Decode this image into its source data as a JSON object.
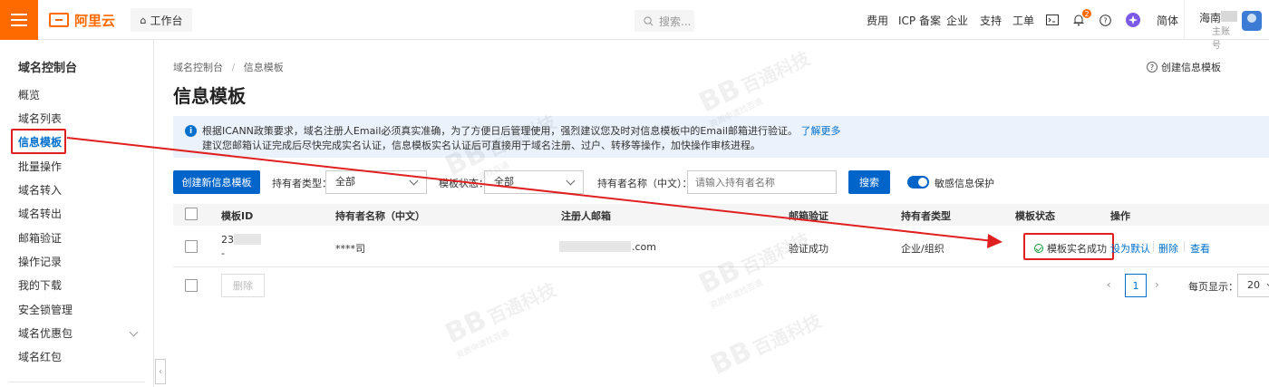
{
  "topbar": {
    "logo_text": "阿里云",
    "workbench_label": "工作台",
    "search_placeholder": "搜索...",
    "nav": [
      "费用",
      "ICP 备案",
      "企业",
      "支持",
      "工单"
    ],
    "notification_count": "2",
    "lang_label": "简体",
    "account_name": "海南",
    "account_role": "主账号"
  },
  "sidebar": {
    "title": "域名控制台",
    "items": [
      "概览",
      "域名列表",
      "信息模板",
      "批量操作",
      "域名转入",
      "域名转出",
      "邮箱验证",
      "操作记录",
      "我的下载",
      "安全锁管理",
      "域名优惠包",
      "域名红包"
    ]
  },
  "main": {
    "breadcrumb_root": "域名控制台",
    "breadcrumb_sep": "/",
    "breadcrumb_current": "信息模板",
    "title": "信息模板",
    "create_link": "创建信息模板",
    "notice_line1": "根据ICANN政策要求，域名注册人Email必须真实准确，为了方便日后管理使用，强烈建议您及时对信息模板中的Email邮箱进行验证。",
    "notice_link": "了解更多",
    "notice_line2": "建议您邮箱认证完成后尽快完成实名认证，信息模板实名认证后可直接用于域名注册、过户、转移等操作，加快操作审核进程。"
  },
  "filters": {
    "create_button": "创建新信息模板",
    "holder_type_label": "持有者类型：",
    "holder_type_value": "全部",
    "status_label": "模板状态：",
    "status_value": "全部",
    "holder_name_label": "持有者名称（中文）：",
    "holder_name_placeholder": "请输入持有者名称",
    "search_button": "搜索",
    "sensitive_label": "敏感信息保护"
  },
  "table": {
    "headers": [
      "模板ID",
      "持有者名称（中文）",
      "注册人邮箱",
      "邮箱验证",
      "持有者类型",
      "模板状态",
      "操作"
    ],
    "rows": [
      {
        "id": "23",
        "id_sub": "-",
        "holder": "****司",
        "email": ".com",
        "email_verify": "验证成功",
        "holder_type": "企业/组织",
        "status": "模板实名成功",
        "ops": [
          "设为默认",
          "删除",
          "查看"
        ]
      }
    ]
  },
  "footer": {
    "delete_button": "删除",
    "current_page": "1",
    "page_size_label": "每页显示：",
    "page_size_value": "20"
  },
  "watermark": {
    "logo": "BB",
    "title": "百通科技",
    "subtitle": "资质申请找百通"
  },
  "colors": {
    "brand": "#ff6a00",
    "primary": "#0064c8",
    "link": "#0070cc",
    "highlight": "#e02020",
    "success": "#1a9b3a"
  }
}
